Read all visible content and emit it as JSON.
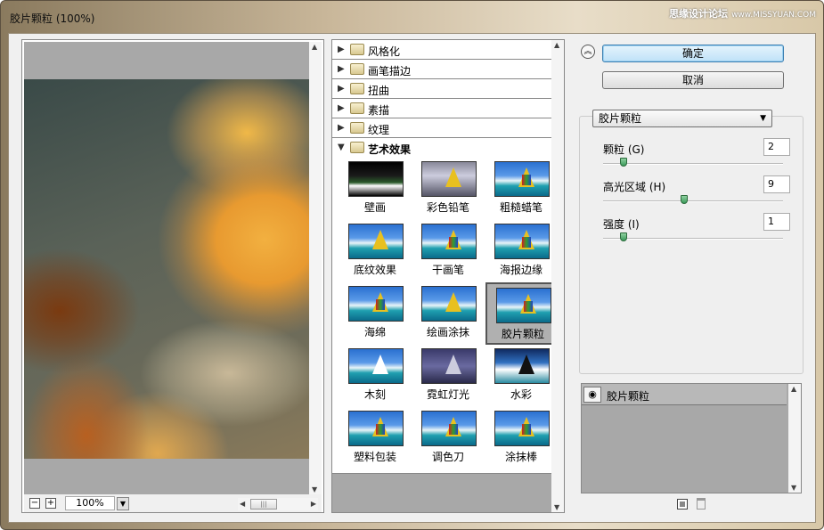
{
  "window": {
    "title": "胶片颗粒 (100%)",
    "watermark_text": "思缘设计论坛",
    "watermark_url": "www.MISSYUAN.COM"
  },
  "preview": {
    "zoom_minus": "−",
    "zoom_plus": "+",
    "zoom_value": "100%"
  },
  "filter_tree": {
    "categories": [
      {
        "label": "风格化",
        "expanded": false
      },
      {
        "label": "画笔描边",
        "expanded": false
      },
      {
        "label": "扭曲",
        "expanded": false
      },
      {
        "label": "素描",
        "expanded": false
      },
      {
        "label": "纹理",
        "expanded": false
      },
      {
        "label": "艺术效果",
        "expanded": true
      }
    ],
    "filters": [
      {
        "label": "壁画"
      },
      {
        "label": "彩色铅笔"
      },
      {
        "label": "粗糙蜡笔"
      },
      {
        "label": "底纹效果"
      },
      {
        "label": "干画笔"
      },
      {
        "label": "海报边缘"
      },
      {
        "label": "海绵"
      },
      {
        "label": "绘画涂抹"
      },
      {
        "label": "胶片颗粒",
        "selected": true
      },
      {
        "label": "木刻"
      },
      {
        "label": "霓虹灯光"
      },
      {
        "label": "水彩"
      },
      {
        "label": "塑料包装"
      },
      {
        "label": "调色刀"
      },
      {
        "label": "涂抹棒"
      }
    ]
  },
  "buttons": {
    "ok": "确定",
    "cancel": "取消"
  },
  "settings": {
    "filter_select": "胶片颗粒",
    "params": [
      {
        "label": "颗粒 (G)",
        "value": "2",
        "level": 0.1
      },
      {
        "label": "高光区域 (H)",
        "value": "9",
        "level": 0.45
      },
      {
        "label": "强度 (I)",
        "value": "1",
        "level": 0.1
      }
    ]
  },
  "layers": {
    "items": [
      {
        "name": "胶片颗粒"
      }
    ]
  }
}
